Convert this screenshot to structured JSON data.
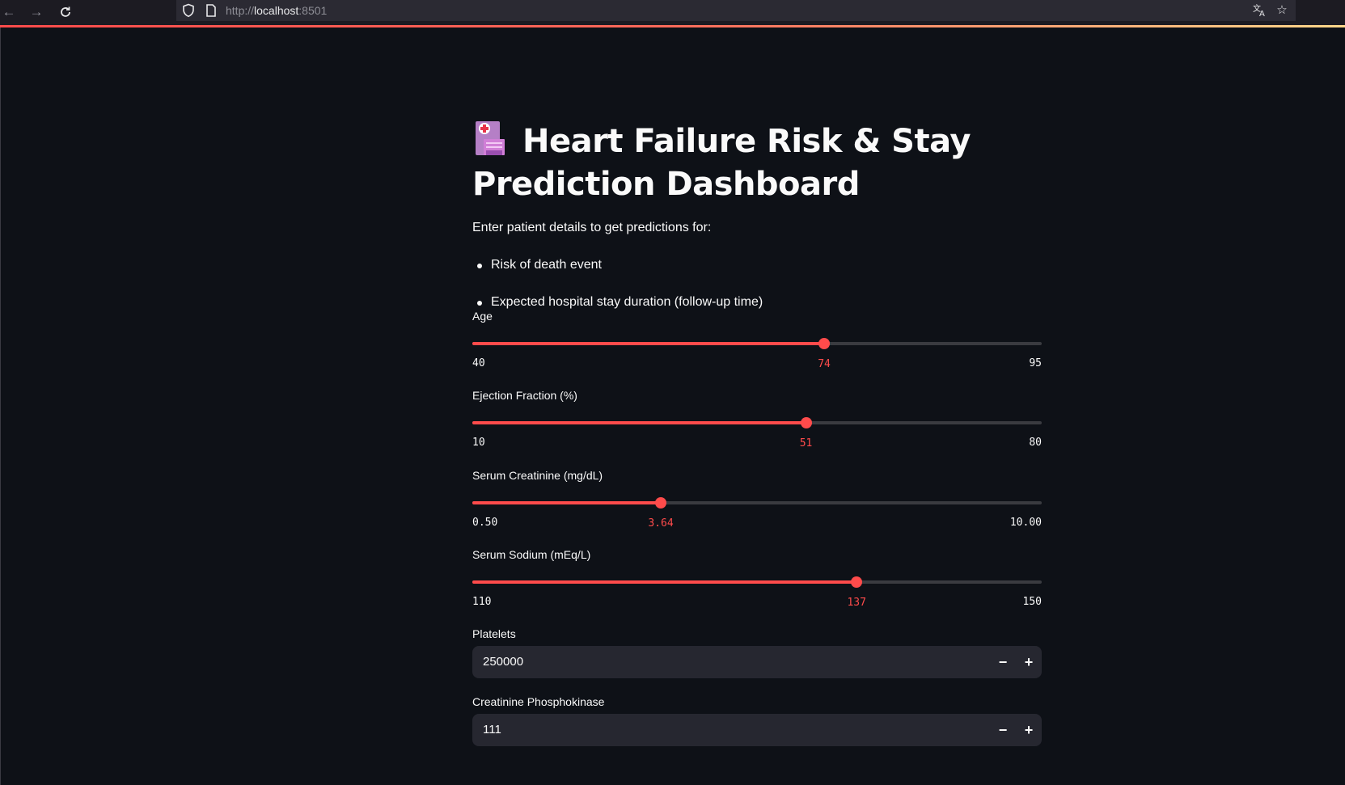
{
  "browser": {
    "url_scheme": "http://",
    "url_host": "localhost",
    "url_port": ":8501"
  },
  "page": {
    "title": "Heart Failure Risk & Stay Prediction Dashboard",
    "title_icon": "hospital-icon",
    "intro": "Enter patient details to get predictions for:",
    "bullets": [
      "Risk of death event",
      "Expected hospital stay duration (follow-up time)"
    ]
  },
  "sliders": [
    {
      "label": "Age",
      "value": "74",
      "min": "40",
      "max": "95",
      "fraction": 0.618
    },
    {
      "label": "Ejection Fraction (%)",
      "value": "51",
      "min": "10",
      "max": "80",
      "fraction": 0.586
    },
    {
      "label": "Serum Creatinine (mg/dL)",
      "value": "3.64",
      "min": "0.50",
      "max": "10.00",
      "fraction": 0.331
    },
    {
      "label": "Serum Sodium (mEq/L)",
      "value": "137",
      "min": "110",
      "max": "150",
      "fraction": 0.675
    }
  ],
  "number_inputs": [
    {
      "label": "Platelets",
      "value": "250000",
      "decrement": "−",
      "increment": "+"
    },
    {
      "label": "Creatinine Phosphokinase",
      "value": "111",
      "decrement": "−",
      "increment": "+"
    }
  ],
  "colors": {
    "background": "#0e1117",
    "accent": "#ff4b4b",
    "input_bg": "#262730"
  }
}
